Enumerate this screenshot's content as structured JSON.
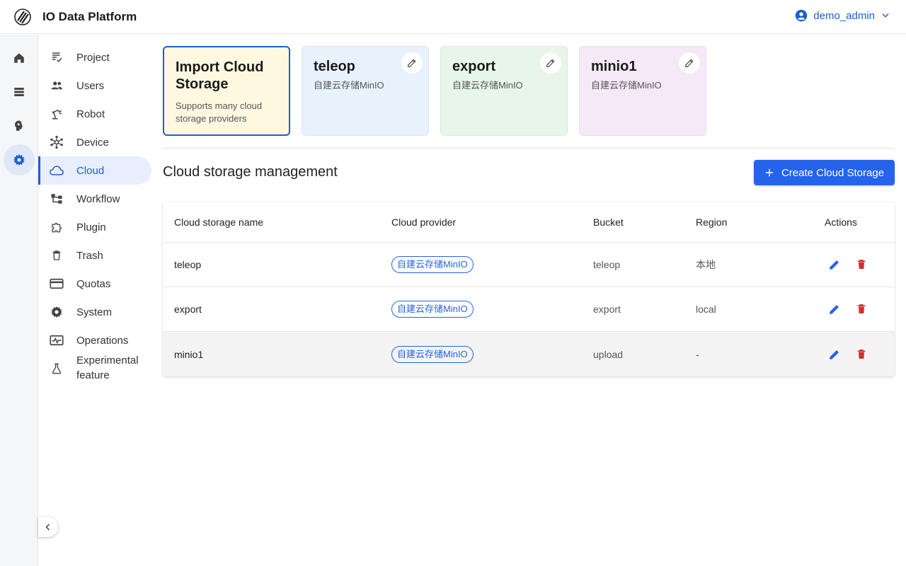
{
  "app": {
    "title": "IO Data Platform"
  },
  "user": {
    "name": "demo_admin"
  },
  "rail": [
    "home-icon",
    "storage-icon",
    "brain-icon",
    "settings-icon"
  ],
  "menu": {
    "items": [
      {
        "label": "Project",
        "icon": "project-icon"
      },
      {
        "label": "Users",
        "icon": "users-icon"
      },
      {
        "label": "Robot",
        "icon": "robot-arm-icon"
      },
      {
        "label": "Device",
        "icon": "device-icon"
      },
      {
        "label": "Cloud",
        "icon": "cloud-icon"
      },
      {
        "label": "Workflow",
        "icon": "workflow-icon"
      },
      {
        "label": "Plugin",
        "icon": "plugin-icon"
      },
      {
        "label": "Trash",
        "icon": "trash-icon"
      },
      {
        "label": "Quotas",
        "icon": "card-icon"
      },
      {
        "label": "System",
        "icon": "gear-icon"
      },
      {
        "label": "Operations",
        "icon": "monitor-icon"
      },
      {
        "label": "Experimental\nfeature",
        "icon": "flask-icon"
      }
    ],
    "active": "Cloud"
  },
  "cards": {
    "import": {
      "title": "Import Cloud Storage",
      "subtitle": "Supports many cloud storage providers"
    },
    "storages": [
      {
        "name": "teleop",
        "provider": "自建云存储MinIO"
      },
      {
        "name": "export",
        "provider": "自建云存储MinIO"
      },
      {
        "name": "minio1",
        "provider": "自建云存储MinIO"
      }
    ]
  },
  "section": {
    "title": "Cloud storage management",
    "create_label": "Create Cloud Storage"
  },
  "table": {
    "headers": {
      "name": "Cloud storage name",
      "provider": "Cloud provider",
      "bucket": "Bucket",
      "region": "Region",
      "actions": "Actions"
    },
    "rows": [
      {
        "name": "teleop",
        "provider": "自建云存储MinIO",
        "bucket": "teleop",
        "region": "本地"
      },
      {
        "name": "export",
        "provider": "自建云存储MinIO",
        "bucket": "export",
        "region": "local"
      },
      {
        "name": "minio1",
        "provider": "自建云存储MinIO",
        "bucket": "upload",
        "region": "-"
      }
    ]
  },
  "colors": {
    "accent": "#2563eb",
    "danger": "#d32f2f"
  }
}
